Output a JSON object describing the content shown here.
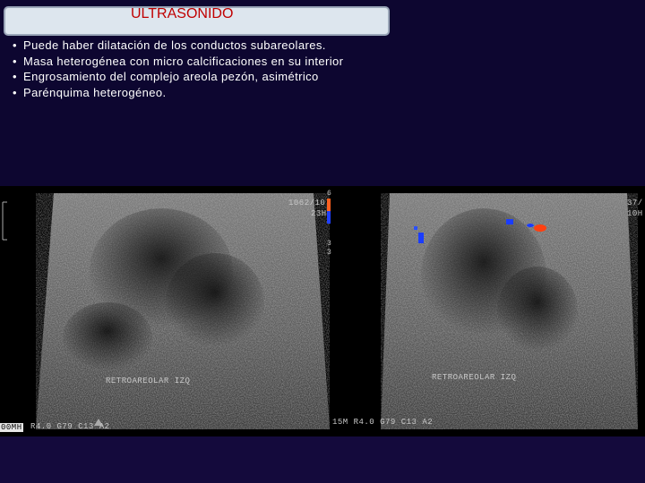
{
  "slide": {
    "title": "ULTRASONIDO",
    "bullets": [
      "Puede haber dilatación de los conductos subareolares.",
      "Masa heterogénea con micro calcificaciones en su interior",
      "Engrosamiento del complejo areola pezón, asimétrico",
      "Parénquima heterogéneo."
    ],
    "bullet_symbol": "•"
  },
  "ultrasound": {
    "left": {
      "label": "RETROAREOLAR    IZQ",
      "settings_top": "1062/10",
      "settings_top2": "23H",
      "footer": "R4.0  G79  C13  A2",
      "freq_cut": "00MH"
    },
    "right": {
      "label": "RETROAREOLAR    IZQ",
      "settings_top": "37/",
      "settings_top2": "10H",
      "footer": "15M  R4.0  G79  C13  A2"
    },
    "colorbar_marks": [
      "6",
      "3",
      "3",
      "5"
    ]
  },
  "colors": {
    "background": "#0d0630",
    "title_text": "#c00000",
    "title_box": "#dde6ee",
    "doppler_blue": "#1a3cff",
    "doppler_red": "#ff4010"
  }
}
